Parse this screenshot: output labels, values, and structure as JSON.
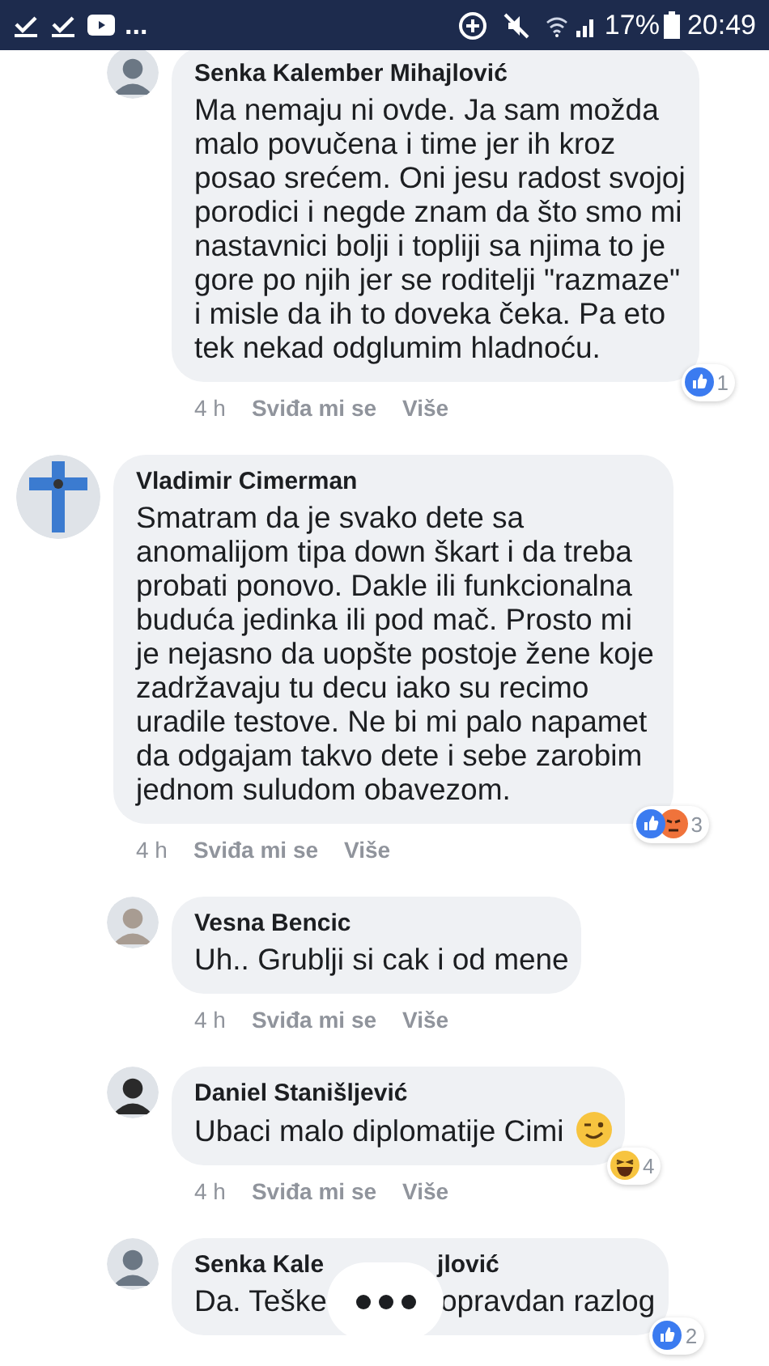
{
  "status_bar": {
    "notifications": [
      {
        "kind": "check"
      },
      {
        "kind": "check"
      },
      {
        "kind": "video"
      }
    ],
    "more": "...",
    "battery": "17%",
    "time": "20:49"
  },
  "comments": [
    {
      "kind": "reply",
      "author": [
        "Senka Kalember Mihajlović"
      ],
      "text": [
        "Ma nemaju ni ovde. Ja sam možda malo povučena i time jer ih kroz posao srećem. Oni jesu radost svojoj porodici i negde znam da što smo mi nastavnici bolji i topliji sa njima to je gore po njih jer se roditelji \"razmaze\" i misle da ih to doveka čeka. Pa eto tek nekad odglumim hladnoću."
      ],
      "reactions": [
        {
          "kind": "like"
        }
      ],
      "reaction_count": "1",
      "time": "4 h",
      "like": "Sviđa mi se",
      "more": "Više"
    },
    {
      "kind": "comment",
      "author": [
        "Vladimir Cimerman"
      ],
      "text": [
        "Smatram da je svako dete sa anomalijom tipa down škart i da treba probati ponovo. Dakle ili funkcionalna buduća jedinka ili pod mač. Prosto mi je nejasno da uopšte postoje žene koje zadržavaju tu decu iako su recimo uradile testove. Ne bi mi palo napamet da odgajam takvo dete i sebe zarobim jednom suludom obavezom."
      ],
      "reactions": [
        {
          "kind": "like"
        },
        {
          "kind": "angry"
        }
      ],
      "reaction_count": "3",
      "time": "4 h",
      "like": "Sviđa mi se",
      "more": "Više"
    },
    {
      "kind": "reply",
      "author": [
        "Vesna Bencic"
      ],
      "text": [
        "Uh.. Grublji si cak i od mene"
      ],
      "time": "4 h",
      "like": "Sviđa mi se",
      "more": "Više"
    },
    {
      "kind": "reply",
      "author": [
        "Daniel Stanišljević"
      ],
      "text": [
        "Ubaci malo diplomatije Cimi"
      ],
      "emoji": {
        "kind": "wink"
      },
      "reactions": [
        {
          "kind": "haha"
        }
      ],
      "reaction_count": "4",
      "time": "4 h",
      "like": "Sviđa mi se",
      "more": "Više"
    },
    {
      "kind": "reply",
      "author": [
        "Senka Kale",
        "jlović"
      ],
      "text": [
        "Da. Teške",
        "opravdan razlog"
      ],
      "reactions": [
        {
          "kind": "like"
        }
      ],
      "reaction_count": "2"
    }
  ]
}
